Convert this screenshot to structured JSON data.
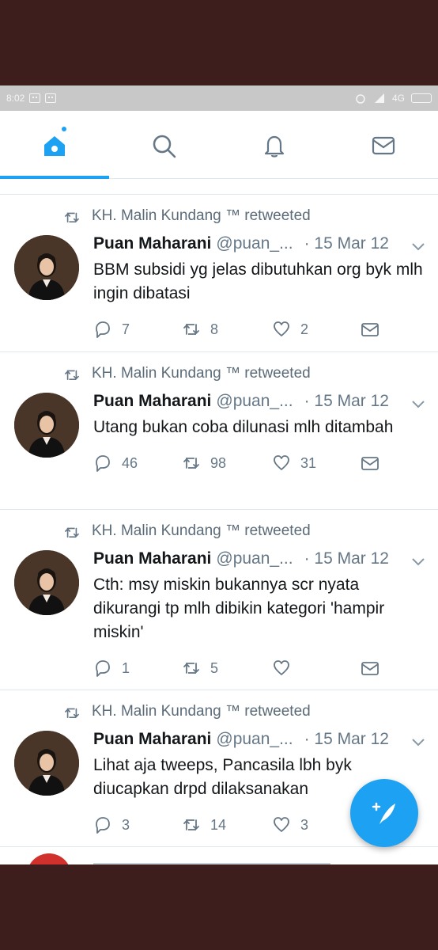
{
  "status_bar": {
    "time": "8:02",
    "network": "4G"
  },
  "nav": {
    "tabs": [
      {
        "name": "home",
        "icon": "home-icon"
      },
      {
        "name": "search",
        "icon": "search-icon"
      },
      {
        "name": "notifications",
        "icon": "bell-icon"
      },
      {
        "name": "messages",
        "icon": "mail-icon"
      }
    ],
    "active_tab": "home"
  },
  "colors": {
    "accent": "#1da1f2",
    "text": "#14171a",
    "muted": "#657786",
    "border": "#e1e8ed",
    "frame": "#3d1e1c"
  },
  "tweets": [
    {
      "retweeted_by": "KH. Malin Kundang ™ retweeted",
      "name": "Puan Maharani",
      "handle": "@puan_...",
      "date": "· 15 Mar 12",
      "text": "BBM subsidi yg jelas dibutuhkan org byk mlh ingin dibatasi",
      "replies": "7",
      "retweets": "8",
      "likes": "2"
    },
    {
      "retweeted_by": "KH. Malin Kundang ™ retweeted",
      "name": "Puan Maharani",
      "handle": "@puan_...",
      "date": "· 15 Mar 12",
      "text": "Utang bukan coba dilunasi mlh ditambah",
      "replies": "46",
      "retweets": "98",
      "likes": "31"
    },
    {
      "retweeted_by": "KH. Malin Kundang ™ retweeted",
      "name": "Puan Maharani",
      "handle": "@puan_...",
      "date": "· 15 Mar 12",
      "text": "Cth: msy miskin bukannya scr nyata dikurangi tp mlh dibikin kategori 'hampir miskin'",
      "replies": "1",
      "retweets": "5",
      "likes": ""
    },
    {
      "retweeted_by": "KH. Malin Kundang ™ retweeted",
      "name": "Puan Maharani",
      "handle": "@puan_...",
      "date": "· 15 Mar 12",
      "text": "Lihat aja tweeps, Pancasila lbh byk diucapkan drpd dilaksanakan",
      "replies": "3",
      "retweets": "14",
      "likes": "3"
    }
  ],
  "fab": {
    "icon": "compose-tweet-icon"
  }
}
